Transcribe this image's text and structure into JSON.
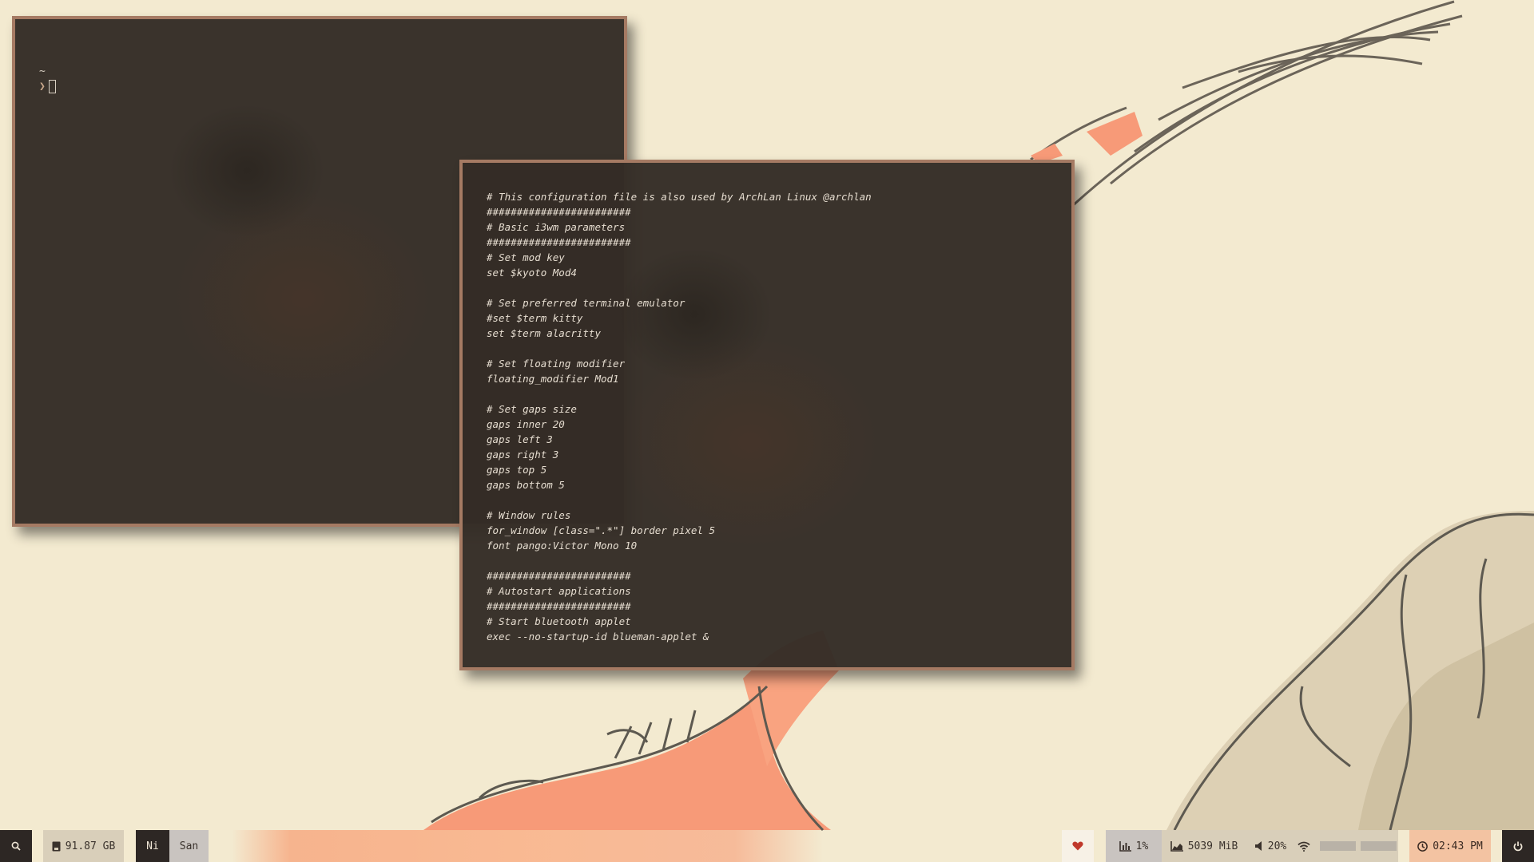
{
  "terminal_1": {
    "prompt_dir": "~",
    "prompt_symbol": "❯"
  },
  "terminal_2": {
    "lines": [
      "# This configuration file is also used by ArchLan Linux @archlan",
      "########################",
      "# Basic i3wm parameters",
      "########################",
      "# Set mod key",
      "set $kyoto Mod4",
      "",
      "# Set preferred terminal emulator",
      "#set $term kitty",
      "set $term alacritty",
      "",
      "# Set floating modifier",
      "floating_modifier Mod1",
      "",
      "# Set gaps size",
      "gaps inner 20",
      "gaps left 3",
      "gaps right 3",
      "gaps top 5",
      "gaps bottom 5",
      "",
      "# Window rules",
      "for_window [class=\".*\"] border pixel 5",
      "font pango:Victor Mono 10",
      "",
      "########################",
      "# Autostart applications",
      "########################",
      "# Start bluetooth applet",
      "exec --no-startup-id blueman-applet &"
    ]
  },
  "statusbar": {
    "disk": "91.87 GB",
    "workspaces": [
      "Ni",
      "San"
    ],
    "active_workspace": "Ni",
    "cpu": "1%",
    "memory": "5039 MiB",
    "volume": "20%",
    "time": "02:43 PM"
  },
  "colors": {
    "wallpaper": "#f3ead0",
    "terminal_bg": "#342c26",
    "terminal_border": "#a57a63",
    "bar_dark": "#2d2724",
    "bar_light": "#d9cfba",
    "bar_peach": "#f3c3a2",
    "heart": "#c0392b"
  },
  "icons": {
    "launcher": "search-icon",
    "disk": "disk-icon",
    "favorite": "heart-icon",
    "cpu": "bar-chart-icon",
    "memory": "area-chart-icon",
    "volume": "speaker-icon",
    "network": "wifi-icon",
    "clock": "clock-icon",
    "power": "power-icon"
  }
}
